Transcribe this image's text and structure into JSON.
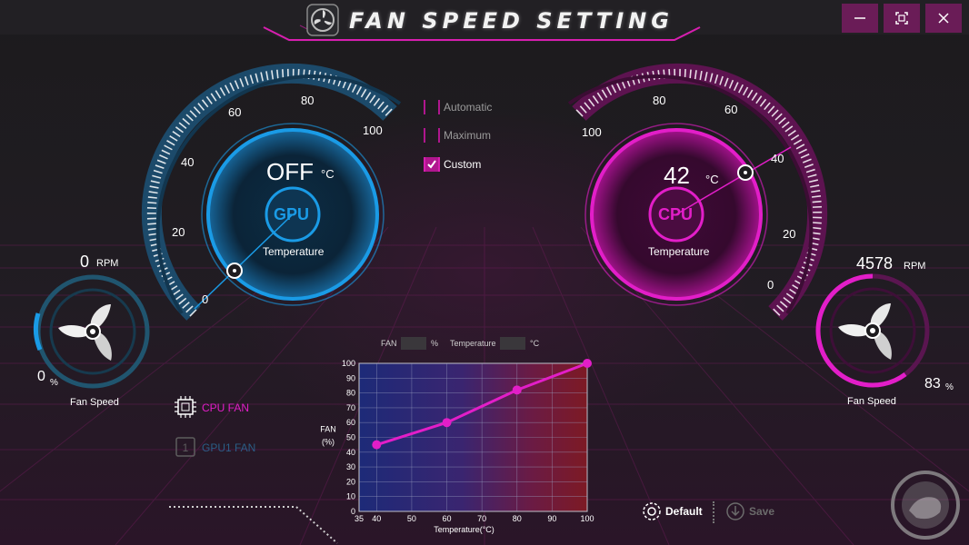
{
  "app": {
    "title": "FAN SPEED SETTING"
  },
  "window_controls": {
    "minimize_icon": "minimize-icon",
    "restore_icon": "restore-icon",
    "close_icon": "close-icon"
  },
  "colors": {
    "gpu": "#1a9be6",
    "cpu": "#e21ec8",
    "accent": "#b0168e",
    "curve": "#e21ec8"
  },
  "gpu": {
    "chip": "GPU",
    "temperature": "OFF",
    "unit": "°C",
    "caption": "Temperature",
    "ticks": [
      "0",
      "20",
      "40",
      "60",
      "80",
      "100"
    ],
    "fan": {
      "rpm": "0",
      "rpm_unit": "RPM",
      "percent": "0",
      "percent_unit": "%",
      "caption": "Fan Speed",
      "level": 0
    }
  },
  "cpu": {
    "chip": "CPU",
    "temperature": "42",
    "unit": "°C",
    "caption": "Temperature",
    "ticks": [
      "100",
      "80",
      "60",
      "40",
      "20",
      "0"
    ],
    "fan": {
      "rpm": "4578",
      "rpm_unit": "RPM",
      "percent": "83",
      "percent_unit": "%",
      "caption": "Fan Speed",
      "level": 0.83
    }
  },
  "modes": [
    {
      "label": "Automatic",
      "checked": false
    },
    {
      "label": "Maximum",
      "checked": false
    },
    {
      "label": "Custom",
      "checked": true
    }
  ],
  "fan_select": [
    {
      "label": "CPU FAN",
      "active": true
    },
    {
      "label": "GPU1 FAN",
      "active": false
    }
  ],
  "curve_fields": {
    "fan_label": "FAN",
    "fan_value": "",
    "fan_unit": "%",
    "temp_label": "Temperature",
    "temp_value": "",
    "temp_unit": "°C"
  },
  "chart_data": {
    "type": "line",
    "xlabel": "Temperature(°C)",
    "ylabel_line1": "FAN",
    "ylabel_line2": "(%)",
    "x_ticks": [
      "35",
      "40",
      "50",
      "60",
      "70",
      "80",
      "90",
      "100"
    ],
    "y_ticks": [
      "0",
      "10",
      "20",
      "30",
      "40",
      "50",
      "60",
      "70",
      "80",
      "90",
      "100"
    ],
    "xlim": [
      35,
      100
    ],
    "ylim": [
      0,
      100
    ],
    "grid": true,
    "series": [
      {
        "x": [
          40,
          60,
          80,
          100
        ],
        "y": [
          45,
          60,
          82,
          100
        ]
      }
    ]
  },
  "actions": {
    "default_label": "Default",
    "save_label": "Save"
  }
}
